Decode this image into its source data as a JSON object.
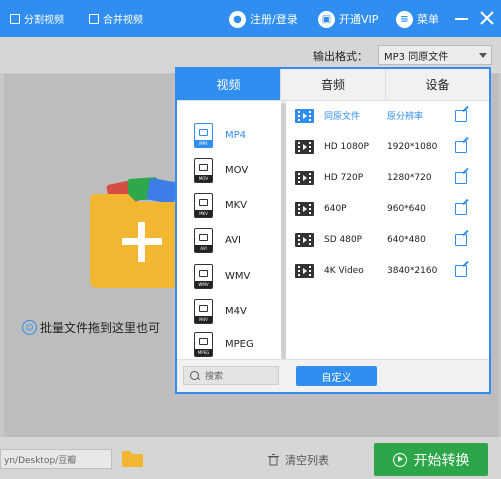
{
  "titlebar": {
    "register_login": "注册/登录",
    "vip": "开通VIP",
    "menu": "菜单",
    "minimize_icon": "minus",
    "close_icon": "close"
  },
  "toolbar": {
    "split_video": "分割视频",
    "merge_video": "合并视频",
    "output_format_label": "输出格式：",
    "output_format_value": "MP3  同原文件"
  },
  "main": {
    "drop_hint": "批量文件拖到这里也可"
  },
  "bottom": {
    "path": "yn/Desktop/豆瓣",
    "clear_list": "清空列表",
    "start_convert": "开始转换"
  },
  "panel": {
    "tabs": [
      {
        "label": "视频",
        "active": true
      },
      {
        "label": "音频",
        "active": false
      },
      {
        "label": "设备",
        "active": false
      }
    ],
    "formats": [
      {
        "name": "MP4",
        "tag": "MP4",
        "selected": true
      },
      {
        "name": "MOV",
        "tag": "MOV",
        "selected": false
      },
      {
        "name": "MKV",
        "tag": "MKV",
        "selected": false
      },
      {
        "name": "AVI",
        "tag": "AVI",
        "selected": false
      },
      {
        "name": "WMV",
        "tag": "WMV",
        "selected": false
      },
      {
        "name": "M4V",
        "tag": "M4V",
        "selected": false
      },
      {
        "name": "MPEG",
        "tag": "MPEG",
        "selected": false
      }
    ],
    "resolutions": [
      {
        "name": "同原文件",
        "value": "原分辨率",
        "selected": true
      },
      {
        "name": "HD 1080P",
        "value": "1920*1080",
        "selected": false
      },
      {
        "name": "HD 720P",
        "value": "1280*720",
        "selected": false
      },
      {
        "name": "640P",
        "value": "960*640",
        "selected": false
      },
      {
        "name": "SD 480P",
        "value": "640*480",
        "selected": false
      },
      {
        "name": "4K Video",
        "value": "3840*2160",
        "selected": false
      }
    ],
    "search_placeholder": "搜索",
    "custom_button": "自定义"
  },
  "colors": {
    "accent": "#2f8ef0",
    "start_button": "#2ca649",
    "folder": "#f2b630"
  }
}
